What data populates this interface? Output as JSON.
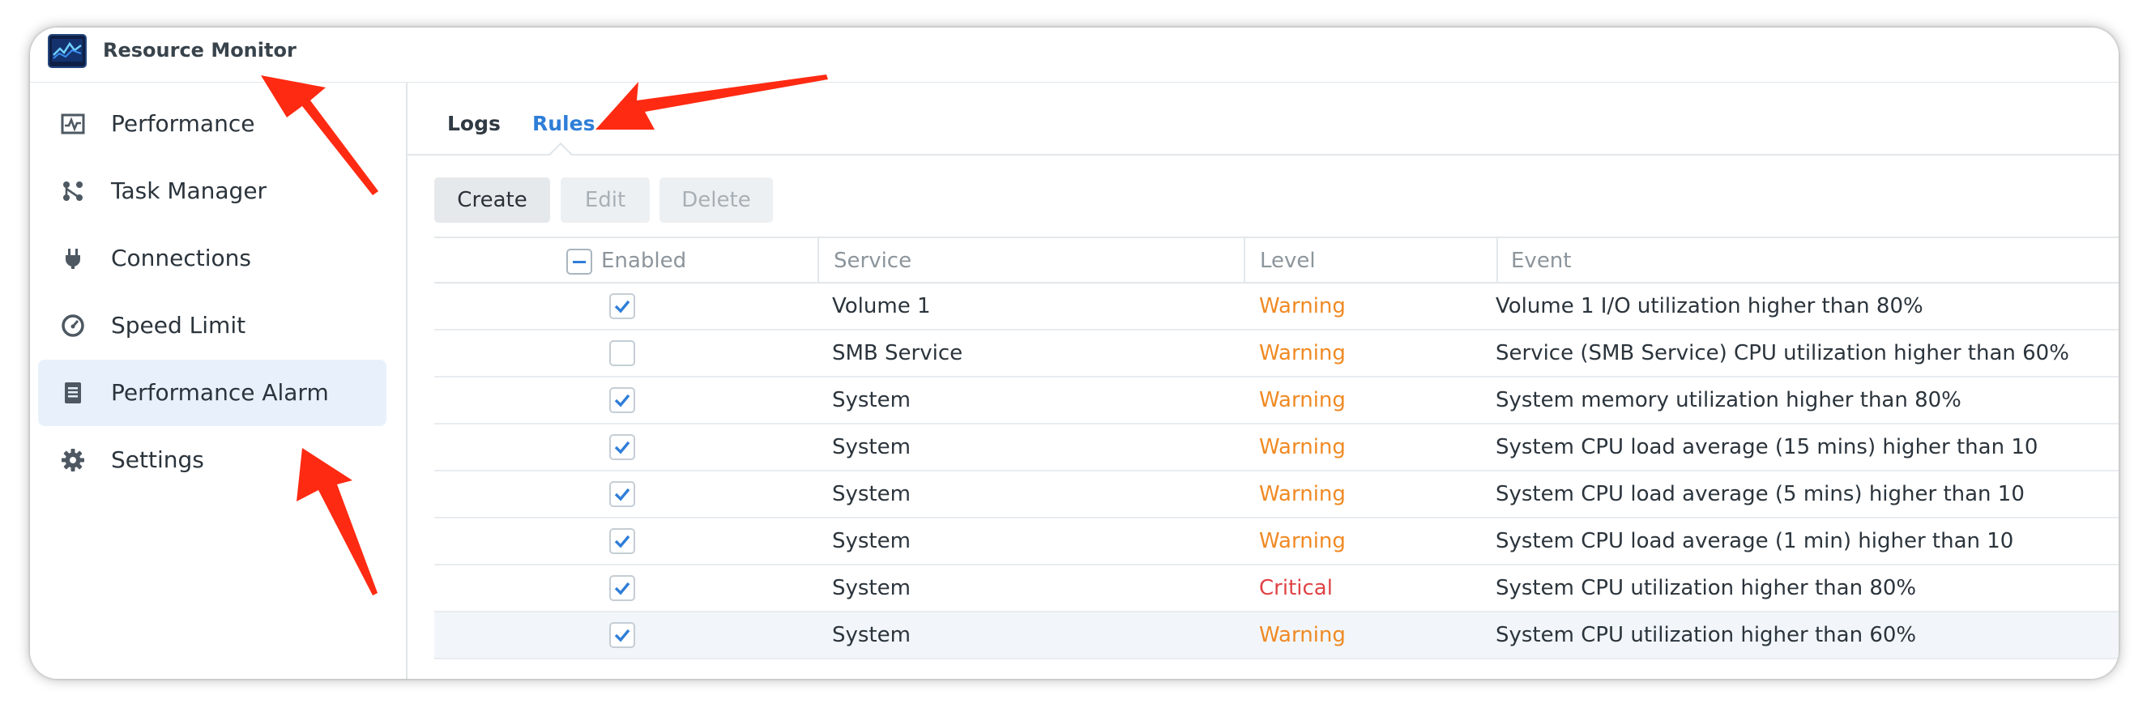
{
  "app": {
    "title": "Resource Monitor",
    "icon": "resource-monitor-icon"
  },
  "sidebar": {
    "items": [
      {
        "label": "Performance",
        "icon": "performance-chart-icon",
        "active": false
      },
      {
        "label": "Task Manager",
        "icon": "task-manager-icon",
        "active": false
      },
      {
        "label": "Connections",
        "icon": "plug-icon",
        "active": false
      },
      {
        "label": "Speed Limit",
        "icon": "speedometer-icon",
        "active": false
      },
      {
        "label": "Performance Alarm",
        "icon": "alarm-document-icon",
        "active": true
      },
      {
        "label": "Settings",
        "icon": "gear-icon",
        "active": false
      }
    ]
  },
  "tabs": [
    {
      "label": "Logs",
      "active": false
    },
    {
      "label": "Rules",
      "active": true
    }
  ],
  "toolbar": {
    "create": "Create",
    "edit": "Edit",
    "delete": "Delete"
  },
  "table": {
    "columns": [
      "Enabled",
      "Service",
      "Level",
      "Event"
    ],
    "rows": [
      {
        "enabled": true,
        "service": "Volume 1",
        "level": "Warning",
        "event": "Volume 1 I/O utilization higher than 80%"
      },
      {
        "enabled": false,
        "service": "SMB Service",
        "level": "Warning",
        "event": "Service (SMB Service) CPU utilization higher than 60%"
      },
      {
        "enabled": true,
        "service": "System",
        "level": "Warning",
        "event": "System memory utilization higher than 80%"
      },
      {
        "enabled": true,
        "service": "System",
        "level": "Warning",
        "event": "System CPU load average (15 mins) higher than 10"
      },
      {
        "enabled": true,
        "service": "System",
        "level": "Warning",
        "event": "System CPU load average (5 mins) higher than 10"
      },
      {
        "enabled": true,
        "service": "System",
        "level": "Warning",
        "event": "System CPU load average (1 min) higher than 10"
      },
      {
        "enabled": true,
        "service": "System",
        "level": "Critical",
        "event": "System CPU utilization higher than 80%"
      },
      {
        "enabled": true,
        "service": "System",
        "level": "Warning",
        "event": "System CPU utilization higher than 60%"
      }
    ],
    "selected_row": 7
  },
  "colors": {
    "accent": "#2f7ed8",
    "warning": "#f08a24",
    "critical": "#e04346",
    "annotation": "#ff2a12"
  }
}
